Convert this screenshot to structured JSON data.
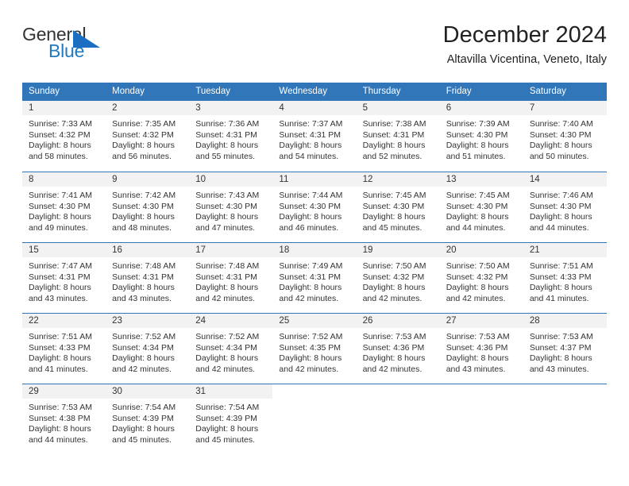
{
  "brand": {
    "name_part1": "General",
    "name_part2": "Blue",
    "triangle_icon": "triangle-icon",
    "accent_color": "#1b6ec2",
    "header_color": "#3076b8"
  },
  "header": {
    "title": "December 2024",
    "subtitle": "Altavilla Vicentina, Veneto, Italy"
  },
  "weekdays": [
    "Sunday",
    "Monday",
    "Tuesday",
    "Wednesday",
    "Thursday",
    "Friday",
    "Saturday"
  ],
  "weeks": [
    [
      {
        "day": "1",
        "sunrise": "Sunrise: 7:33 AM",
        "sunset": "Sunset: 4:32 PM",
        "daylight1": "Daylight: 8 hours",
        "daylight2": "and 58 minutes."
      },
      {
        "day": "2",
        "sunrise": "Sunrise: 7:35 AM",
        "sunset": "Sunset: 4:32 PM",
        "daylight1": "Daylight: 8 hours",
        "daylight2": "and 56 minutes."
      },
      {
        "day": "3",
        "sunrise": "Sunrise: 7:36 AM",
        "sunset": "Sunset: 4:31 PM",
        "daylight1": "Daylight: 8 hours",
        "daylight2": "and 55 minutes."
      },
      {
        "day": "4",
        "sunrise": "Sunrise: 7:37 AM",
        "sunset": "Sunset: 4:31 PM",
        "daylight1": "Daylight: 8 hours",
        "daylight2": "and 54 minutes."
      },
      {
        "day": "5",
        "sunrise": "Sunrise: 7:38 AM",
        "sunset": "Sunset: 4:31 PM",
        "daylight1": "Daylight: 8 hours",
        "daylight2": "and 52 minutes."
      },
      {
        "day": "6",
        "sunrise": "Sunrise: 7:39 AM",
        "sunset": "Sunset: 4:30 PM",
        "daylight1": "Daylight: 8 hours",
        "daylight2": "and 51 minutes."
      },
      {
        "day": "7",
        "sunrise": "Sunrise: 7:40 AM",
        "sunset": "Sunset: 4:30 PM",
        "daylight1": "Daylight: 8 hours",
        "daylight2": "and 50 minutes."
      }
    ],
    [
      {
        "day": "8",
        "sunrise": "Sunrise: 7:41 AM",
        "sunset": "Sunset: 4:30 PM",
        "daylight1": "Daylight: 8 hours",
        "daylight2": "and 49 minutes."
      },
      {
        "day": "9",
        "sunrise": "Sunrise: 7:42 AM",
        "sunset": "Sunset: 4:30 PM",
        "daylight1": "Daylight: 8 hours",
        "daylight2": "and 48 minutes."
      },
      {
        "day": "10",
        "sunrise": "Sunrise: 7:43 AM",
        "sunset": "Sunset: 4:30 PM",
        "daylight1": "Daylight: 8 hours",
        "daylight2": "and 47 minutes."
      },
      {
        "day": "11",
        "sunrise": "Sunrise: 7:44 AM",
        "sunset": "Sunset: 4:30 PM",
        "daylight1": "Daylight: 8 hours",
        "daylight2": "and 46 minutes."
      },
      {
        "day": "12",
        "sunrise": "Sunrise: 7:45 AM",
        "sunset": "Sunset: 4:30 PM",
        "daylight1": "Daylight: 8 hours",
        "daylight2": "and 45 minutes."
      },
      {
        "day": "13",
        "sunrise": "Sunrise: 7:45 AM",
        "sunset": "Sunset: 4:30 PM",
        "daylight1": "Daylight: 8 hours",
        "daylight2": "and 44 minutes."
      },
      {
        "day": "14",
        "sunrise": "Sunrise: 7:46 AM",
        "sunset": "Sunset: 4:30 PM",
        "daylight1": "Daylight: 8 hours",
        "daylight2": "and 44 minutes."
      }
    ],
    [
      {
        "day": "15",
        "sunrise": "Sunrise: 7:47 AM",
        "sunset": "Sunset: 4:31 PM",
        "daylight1": "Daylight: 8 hours",
        "daylight2": "and 43 minutes."
      },
      {
        "day": "16",
        "sunrise": "Sunrise: 7:48 AM",
        "sunset": "Sunset: 4:31 PM",
        "daylight1": "Daylight: 8 hours",
        "daylight2": "and 43 minutes."
      },
      {
        "day": "17",
        "sunrise": "Sunrise: 7:48 AM",
        "sunset": "Sunset: 4:31 PM",
        "daylight1": "Daylight: 8 hours",
        "daylight2": "and 42 minutes."
      },
      {
        "day": "18",
        "sunrise": "Sunrise: 7:49 AM",
        "sunset": "Sunset: 4:31 PM",
        "daylight1": "Daylight: 8 hours",
        "daylight2": "and 42 minutes."
      },
      {
        "day": "19",
        "sunrise": "Sunrise: 7:50 AM",
        "sunset": "Sunset: 4:32 PM",
        "daylight1": "Daylight: 8 hours",
        "daylight2": "and 42 minutes."
      },
      {
        "day": "20",
        "sunrise": "Sunrise: 7:50 AM",
        "sunset": "Sunset: 4:32 PM",
        "daylight1": "Daylight: 8 hours",
        "daylight2": "and 42 minutes."
      },
      {
        "day": "21",
        "sunrise": "Sunrise: 7:51 AM",
        "sunset": "Sunset: 4:33 PM",
        "daylight1": "Daylight: 8 hours",
        "daylight2": "and 41 minutes."
      }
    ],
    [
      {
        "day": "22",
        "sunrise": "Sunrise: 7:51 AM",
        "sunset": "Sunset: 4:33 PM",
        "daylight1": "Daylight: 8 hours",
        "daylight2": "and 41 minutes."
      },
      {
        "day": "23",
        "sunrise": "Sunrise: 7:52 AM",
        "sunset": "Sunset: 4:34 PM",
        "daylight1": "Daylight: 8 hours",
        "daylight2": "and 42 minutes."
      },
      {
        "day": "24",
        "sunrise": "Sunrise: 7:52 AM",
        "sunset": "Sunset: 4:34 PM",
        "daylight1": "Daylight: 8 hours",
        "daylight2": "and 42 minutes."
      },
      {
        "day": "25",
        "sunrise": "Sunrise: 7:52 AM",
        "sunset": "Sunset: 4:35 PM",
        "daylight1": "Daylight: 8 hours",
        "daylight2": "and 42 minutes."
      },
      {
        "day": "26",
        "sunrise": "Sunrise: 7:53 AM",
        "sunset": "Sunset: 4:36 PM",
        "daylight1": "Daylight: 8 hours",
        "daylight2": "and 42 minutes."
      },
      {
        "day": "27",
        "sunrise": "Sunrise: 7:53 AM",
        "sunset": "Sunset: 4:36 PM",
        "daylight1": "Daylight: 8 hours",
        "daylight2": "and 43 minutes."
      },
      {
        "day": "28",
        "sunrise": "Sunrise: 7:53 AM",
        "sunset": "Sunset: 4:37 PM",
        "daylight1": "Daylight: 8 hours",
        "daylight2": "and 43 minutes."
      }
    ],
    [
      {
        "day": "29",
        "sunrise": "Sunrise: 7:53 AM",
        "sunset": "Sunset: 4:38 PM",
        "daylight1": "Daylight: 8 hours",
        "daylight2": "and 44 minutes."
      },
      {
        "day": "30",
        "sunrise": "Sunrise: 7:54 AM",
        "sunset": "Sunset: 4:39 PM",
        "daylight1": "Daylight: 8 hours",
        "daylight2": "and 45 minutes."
      },
      {
        "day": "31",
        "sunrise": "Sunrise: 7:54 AM",
        "sunset": "Sunset: 4:39 PM",
        "daylight1": "Daylight: 8 hours",
        "daylight2": "and 45 minutes."
      },
      {
        "day": "",
        "sunrise": "",
        "sunset": "",
        "daylight1": "",
        "daylight2": ""
      },
      {
        "day": "",
        "sunrise": "",
        "sunset": "",
        "daylight1": "",
        "daylight2": ""
      },
      {
        "day": "",
        "sunrise": "",
        "sunset": "",
        "daylight1": "",
        "daylight2": ""
      },
      {
        "day": "",
        "sunrise": "",
        "sunset": "",
        "daylight1": "",
        "daylight2": ""
      }
    ]
  ]
}
